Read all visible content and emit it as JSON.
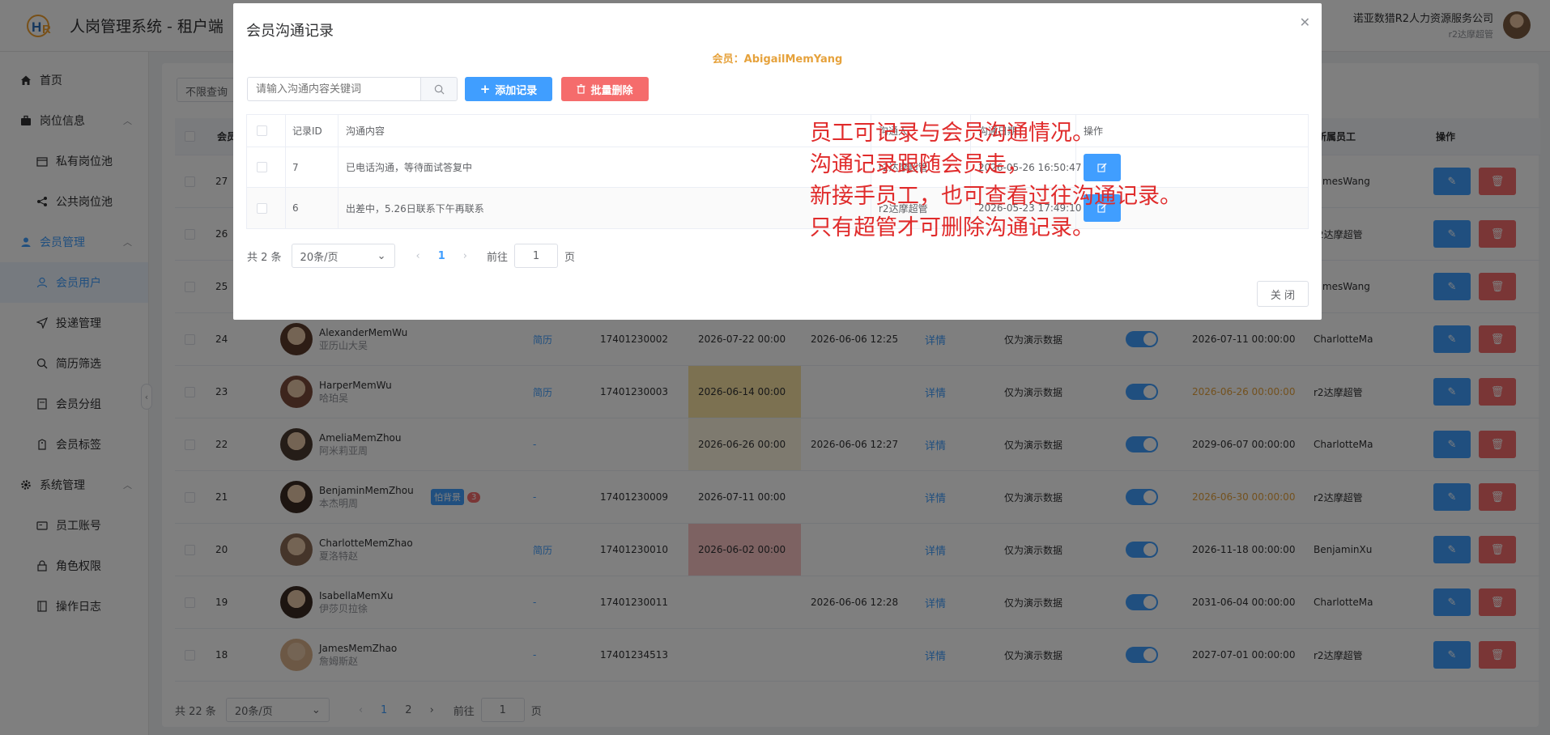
{
  "header": {
    "title": "人岗管理系统 - 租户端",
    "company": "诺亚数猎R2人力资源服务公司",
    "role": "r2达摩超管"
  },
  "sidebar": {
    "items": [
      {
        "label": "首页",
        "icon": "home-icon"
      },
      {
        "label": "岗位信息",
        "icon": "briefcase-icon"
      },
      {
        "label": "私有岗位池",
        "icon": "folder-icon"
      },
      {
        "label": "公共岗位池",
        "icon": "share-icon"
      },
      {
        "label": "会员管理",
        "icon": "user-icon"
      },
      {
        "label": "会员用户",
        "icon": "user-outline-icon"
      },
      {
        "label": "投递管理",
        "icon": "send-icon"
      },
      {
        "label": "简历筛选",
        "icon": "search-icon"
      },
      {
        "label": "会员分组",
        "icon": "group-icon"
      },
      {
        "label": "会员标签",
        "icon": "tag-icon"
      },
      {
        "label": "系统管理",
        "icon": "gear-icon"
      },
      {
        "label": "员工账号",
        "icon": "id-card-icon"
      },
      {
        "label": "角色权限",
        "icon": "lock-icon"
      },
      {
        "label": "操作日志",
        "icon": "log-icon"
      }
    ]
  },
  "background": {
    "filter_label": "不限查询",
    "col_member": "会员",
    "col_employee": "所属员工",
    "col_actions": "操作",
    "rows": [
      {
        "id": "27",
        "name": "",
        "cn": "",
        "resume": "",
        "phone": "",
        "d1": "",
        "d2": "",
        "detail": "",
        "note": "",
        "d3": "",
        "emp": "JamesWang"
      },
      {
        "id": "26",
        "name": "",
        "cn": "",
        "resume": "",
        "phone": "",
        "d1": "",
        "d2": "",
        "detail": "",
        "note": "",
        "d3": "",
        "emp": "r2达摩超管"
      },
      {
        "id": "25",
        "name": "",
        "cn": "",
        "resume": "",
        "phone": "",
        "d1": "",
        "d2": "",
        "detail": "",
        "note": "",
        "d3": "",
        "emp": "JamesWang"
      },
      {
        "id": "24",
        "name": "AlexanderMemWu",
        "cn": "亚历山大吴",
        "resume": "简历",
        "phone": "17401230002",
        "d1": "2026-07-22 00:00",
        "d2": "2026-06-06 12:25",
        "detail": "详情",
        "note": "仅为演示数据",
        "d3": "2026-07-11 00:00:00",
        "emp": "CharlotteMa"
      },
      {
        "id": "23",
        "name": "HarperMemWu",
        "cn": "哈珀吴",
        "resume": "简历",
        "phone": "17401230003",
        "d1": "2026-06-14 00:00",
        "d2": "",
        "detail": "详情",
        "note": "仅为演示数据",
        "d3": "2026-06-26 00:00:00",
        "emp": "r2达摩超管"
      },
      {
        "id": "22",
        "name": "AmeliaMemZhou",
        "cn": "阿米莉亚周",
        "resume": "-",
        "phone": "",
        "d1": "2026-06-26 00:00",
        "d2": "2026-06-06 12:27",
        "detail": "详情",
        "note": "仅为演示数据",
        "d3": "2029-06-07 00:00:00",
        "emp": "CharlotteMa"
      },
      {
        "id": "21",
        "name": "BenjaminMemZhou",
        "cn": "本杰明周",
        "resume": "-",
        "phone": "17401230009",
        "d1": "2026-07-11 00:00",
        "d2": "",
        "detail": "详情",
        "note": "仅为演示数据",
        "d3": "2026-06-30 00:00:00",
        "emp": "r2达摩超管",
        "tag": "怕背景",
        "badge": "3"
      },
      {
        "id": "20",
        "name": "CharlotteMemZhao",
        "cn": "夏洛特赵",
        "resume": "简历",
        "phone": "17401230010",
        "d1": "2026-06-02 00:00",
        "d2": "",
        "detail": "详情",
        "note": "仅为演示数据",
        "d3": "2026-11-18 00:00:00",
        "emp": "BenjaminXu"
      },
      {
        "id": "19",
        "name": "IsabellaMemXu",
        "cn": "伊莎贝拉徐",
        "resume": "-",
        "phone": "17401230011",
        "d1": "",
        "d2": "2026-06-06 12:28",
        "detail": "详情",
        "note": "仅为演示数据",
        "d3": "2031-06-04 00:00:00",
        "emp": "CharlotteMa"
      },
      {
        "id": "18",
        "name": "JamesMemZhao",
        "cn": "詹姆斯赵",
        "resume": "-",
        "phone": "17401234513",
        "d1": "",
        "d2": "",
        "detail": "详情",
        "note": "仅为演示数据",
        "d3": "2027-07-01 00:00:00",
        "emp": "r2达摩超管"
      }
    ],
    "pager": {
      "total": "共 22 条",
      "size": "20条/页",
      "p1": "1",
      "p2": "2",
      "goto": "前往",
      "goto_val": "1",
      "page": "页"
    }
  },
  "dialog": {
    "title": "会员沟通记录",
    "member": "会员：AbigailMemYang",
    "search_placeholder": "请输入沟通内容关键词",
    "add_label": "添加记录",
    "batch_delete_label": "批量删除",
    "columns": {
      "id": "记录ID",
      "content": "沟通内容",
      "person": "沟通人",
      "date": "沟通日期",
      "action": "操作"
    },
    "rows": [
      {
        "id": "7",
        "content": "已电话沟通，等待面试答复中",
        "person": "r2达摩超管",
        "date": "2026-05-26 16:50:47"
      },
      {
        "id": "6",
        "content": "出差中，5.26日联系下午再联系",
        "person": "r2达摩超管",
        "date": "2026-05-23 17:49:10"
      }
    ],
    "annotation": [
      "员工可记录与会员沟通情况。",
      "沟通记录跟随会员走，",
      "新接手员工，也可查看过往沟通记录。",
      "只有超管才可删除沟通记录。"
    ],
    "pager": {
      "total": "共 2 条",
      "size": "20条/页",
      "current": "1",
      "goto": "前往",
      "goto_val": "1",
      "page": "页"
    },
    "close_label": "关 闭"
  }
}
